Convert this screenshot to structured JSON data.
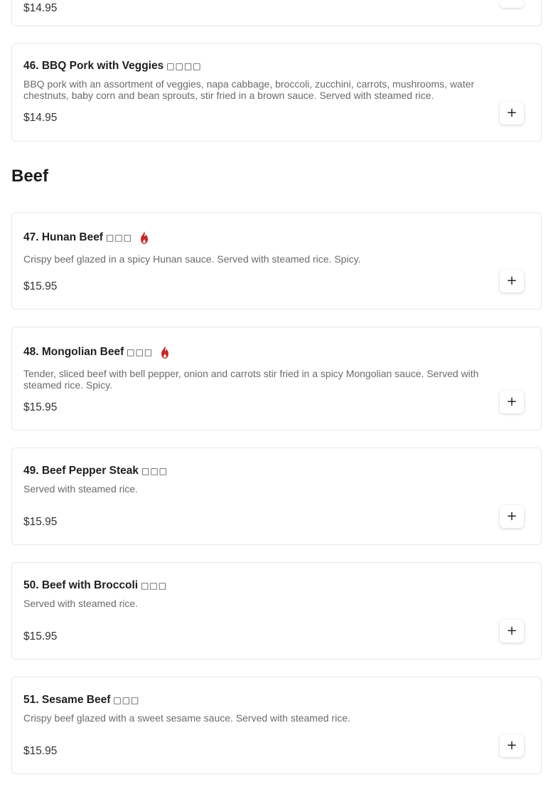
{
  "icons": {
    "add": "plus-icon",
    "spicy": "flame-icon"
  },
  "colors": {
    "spicy": "#c62828",
    "price": "#333333",
    "description": "#6b6b6b"
  },
  "prev_card": {
    "price": "$14.95",
    "add_label": "+"
  },
  "top_items": [
    {
      "name": "46. BBQ Pork with Veggies",
      "cjk": "□□□□",
      "description": "BBQ pork with an assortment of veggies, napa cabbage, broccoli, zucchini, carrots, mushrooms, water chestnuts, baby corn and bean sprouts, stir fried in a brown sauce. Served with steamed rice.",
      "price": "$14.95",
      "spicy": false,
      "add_label": "+"
    }
  ],
  "section": {
    "title": "Beef"
  },
  "beef_items": [
    {
      "name": "47. Hunan Beef",
      "cjk": "□□□",
      "description": "Crispy beef glazed in a spicy Hunan sauce. Served with steamed rice. Spicy.",
      "price": "$15.95",
      "spicy": true,
      "add_label": "+"
    },
    {
      "name": "48. Mongolian Beef",
      "cjk": "□□□",
      "description": "Tender, sliced beef with bell pepper, onion and carrots stir fried in a spicy Mongolian sauce. Served with steamed rice. Spicy.",
      "price": "$15.95",
      "spicy": true,
      "add_label": "+"
    },
    {
      "name": "49. Beef Pepper Steak",
      "cjk": "□□□",
      "description": "Served with steamed rice.",
      "price": "$15.95",
      "spicy": false,
      "add_label": "+"
    },
    {
      "name": "50. Beef with Broccoli",
      "cjk": "□□□",
      "description": "Served with steamed rice.",
      "price": "$15.95",
      "spicy": false,
      "add_label": "+"
    },
    {
      "name": "51. Sesame Beef",
      "cjk": "□□□",
      "description": "Crispy beef glazed with a sweet sesame sauce. Served with steamed rice.",
      "price": "$15.95",
      "spicy": false,
      "add_label": "+"
    }
  ]
}
